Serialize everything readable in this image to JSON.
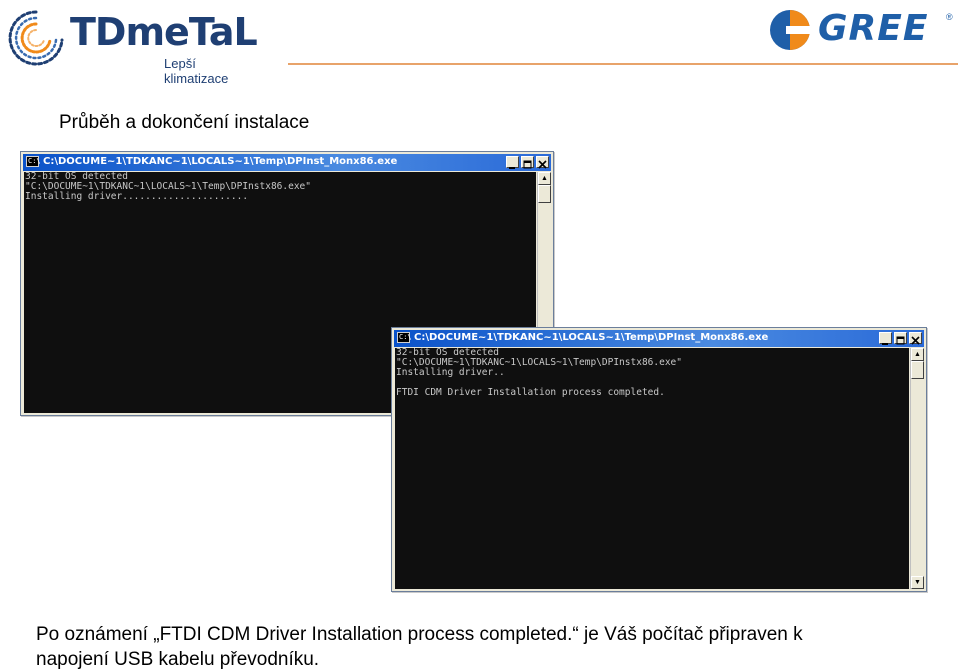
{
  "header": {
    "logo_left_text": "TDmeTaL",
    "logo_left_tagline": "Lepší klimatizace",
    "logo_right_text": "GREE",
    "logo_right_mark": "®",
    "accent_color": "#e8a36a",
    "brand_blue": "#1f3f73",
    "gree_orange": "#f08a1a"
  },
  "heading": "Průběh a dokončení instalace",
  "windows": [
    {
      "title": "C:\\DOCUME~1\\TDKANC~1\\LOCALS~1\\Temp\\DPInst_Monx86.exe",
      "icon": "console-icon",
      "lines": [
        "32-bit OS detected",
        "\"C:\\DOCUME~1\\TDKANC~1\\LOCALS~1\\Temp\\DPInstx86.exe\"",
        "Installing driver......................"
      ]
    },
    {
      "title": "C:\\DOCUME~1\\TDKANC~1\\LOCALS~1\\Temp\\DPInst_Monx86.exe",
      "icon": "console-icon",
      "lines": [
        "32-bit OS detected",
        "\"C:\\DOCUME~1\\TDKANC~1\\LOCALS~1\\Temp\\DPInstx86.exe\"",
        "Installing driver..",
        "",
        "FTDI CDM Driver Installation process completed."
      ]
    }
  ],
  "caption_line1": "Po oznámení „FTDI CDM Driver Installation process completed.“ je Váš počítač připraven k",
  "caption_line2": "napojení USB kabelu převodníku."
}
